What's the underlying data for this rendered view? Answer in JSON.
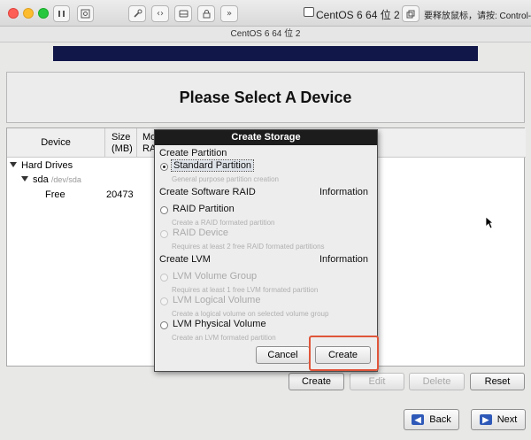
{
  "mac": {
    "vm_name": "CentOS 6 64 位 2",
    "hint": "要释放鼠标，请按: Control-⌘",
    "window_title": "CentOS 6 64 位 2",
    "icons": [
      "pause-icon",
      "snapshot-icon",
      "wrench-icon",
      "code-arrows-icon",
      "drive-icon",
      "lock-icon",
      "chevrons-icon",
      "vm-icon",
      "window-mode-icon"
    ]
  },
  "installer": {
    "heading": "Please Select A Device",
    "columns": {
      "device": "Device",
      "size_line1": "Size",
      "size_line2": "(MB)",
      "mount_line1": "Mo",
      "mount_line2": "RAI"
    },
    "tree": {
      "group": "Hard Drives",
      "disk": "sda",
      "disk_path": "/dev/sda",
      "free_label": "Free",
      "free_size": "20473"
    },
    "buttons": {
      "create": "Create",
      "edit": "Edit",
      "delete": "Delete",
      "reset": "Reset",
      "back": "Back",
      "next": "Next"
    },
    "accent": "#12174a"
  },
  "dialog": {
    "title": "Create Storage",
    "sections": {
      "partition": "Create Partition",
      "software_raid": "Create Software RAID",
      "software_raid_info": "Information",
      "lvm": "Create LVM",
      "lvm_info": "Information"
    },
    "options": {
      "standard_partition": "Standard Partition",
      "standard_partition_desc": "General purpose partition creation",
      "raid_partition": "RAID Partition",
      "raid_partition_desc": "Create a RAID formated partition",
      "raid_device": "RAID Device",
      "raid_device_desc": "Requires at least 2 free RAID formated partitions",
      "lvm_volume_group": "LVM Volume Group",
      "lvm_volume_group_desc": "Requires at least 1 free LVM formated partition",
      "lvm_logical_volume": "LVM Logical Volume",
      "lvm_logical_volume_desc": "Create a logical volume on selected volume group",
      "lvm_physical_volume": "LVM Physical Volume",
      "lvm_physical_volume_desc": "Create an LVM formated partition"
    },
    "selected": "standard_partition",
    "buttons": {
      "cancel": "Cancel",
      "create": "Create"
    },
    "highlight_color": "#e0553a"
  }
}
